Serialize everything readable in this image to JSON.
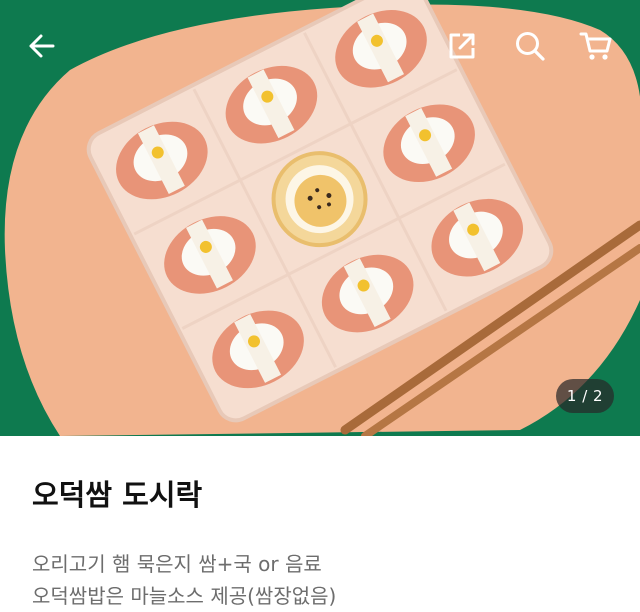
{
  "icons": {
    "back": "arrow-left",
    "share": "external-link",
    "search": "magnifier",
    "cart": "shopping-cart"
  },
  "gallery": {
    "current": 1,
    "total": 2,
    "counter_text": "1 / 2"
  },
  "product": {
    "title": "오덕쌈 도시락",
    "description_line1": "오리고기 햄 묵은지 쌈+국 or 음료",
    "description_line2": "오덕쌈밥은 마늘소스 제공(쌈장없음)"
  },
  "colors": {
    "background_green": "#0e7a4f",
    "mat_peach": "#f2b48f",
    "counter_bg": "#3a3a3a"
  }
}
